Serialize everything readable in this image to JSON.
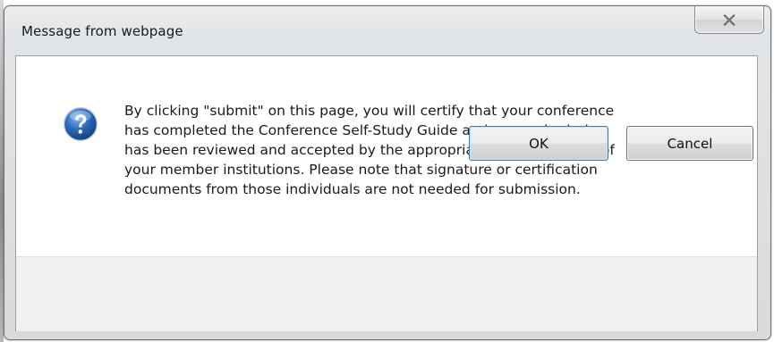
{
  "dialog": {
    "title": "Message from webpage",
    "close_icon": "close-icon",
    "message_icon": "question-icon",
    "message": "By clicking \"submit\" on this page, you will certify that your conference\nhas completed the Conference Self-Study Guide and your submission\nhas been reviewed and accepted by the appropriate parties at each of\nyour member institutions.  Please note that signature or certification\ndocuments from those individuals are not needed for submission.",
    "buttons": {
      "ok_label": "OK",
      "cancel_label": "Cancel"
    }
  },
  "colors": {
    "question_icon_fill": "#2a68b8",
    "default_button_border": "#3c7fb1"
  }
}
